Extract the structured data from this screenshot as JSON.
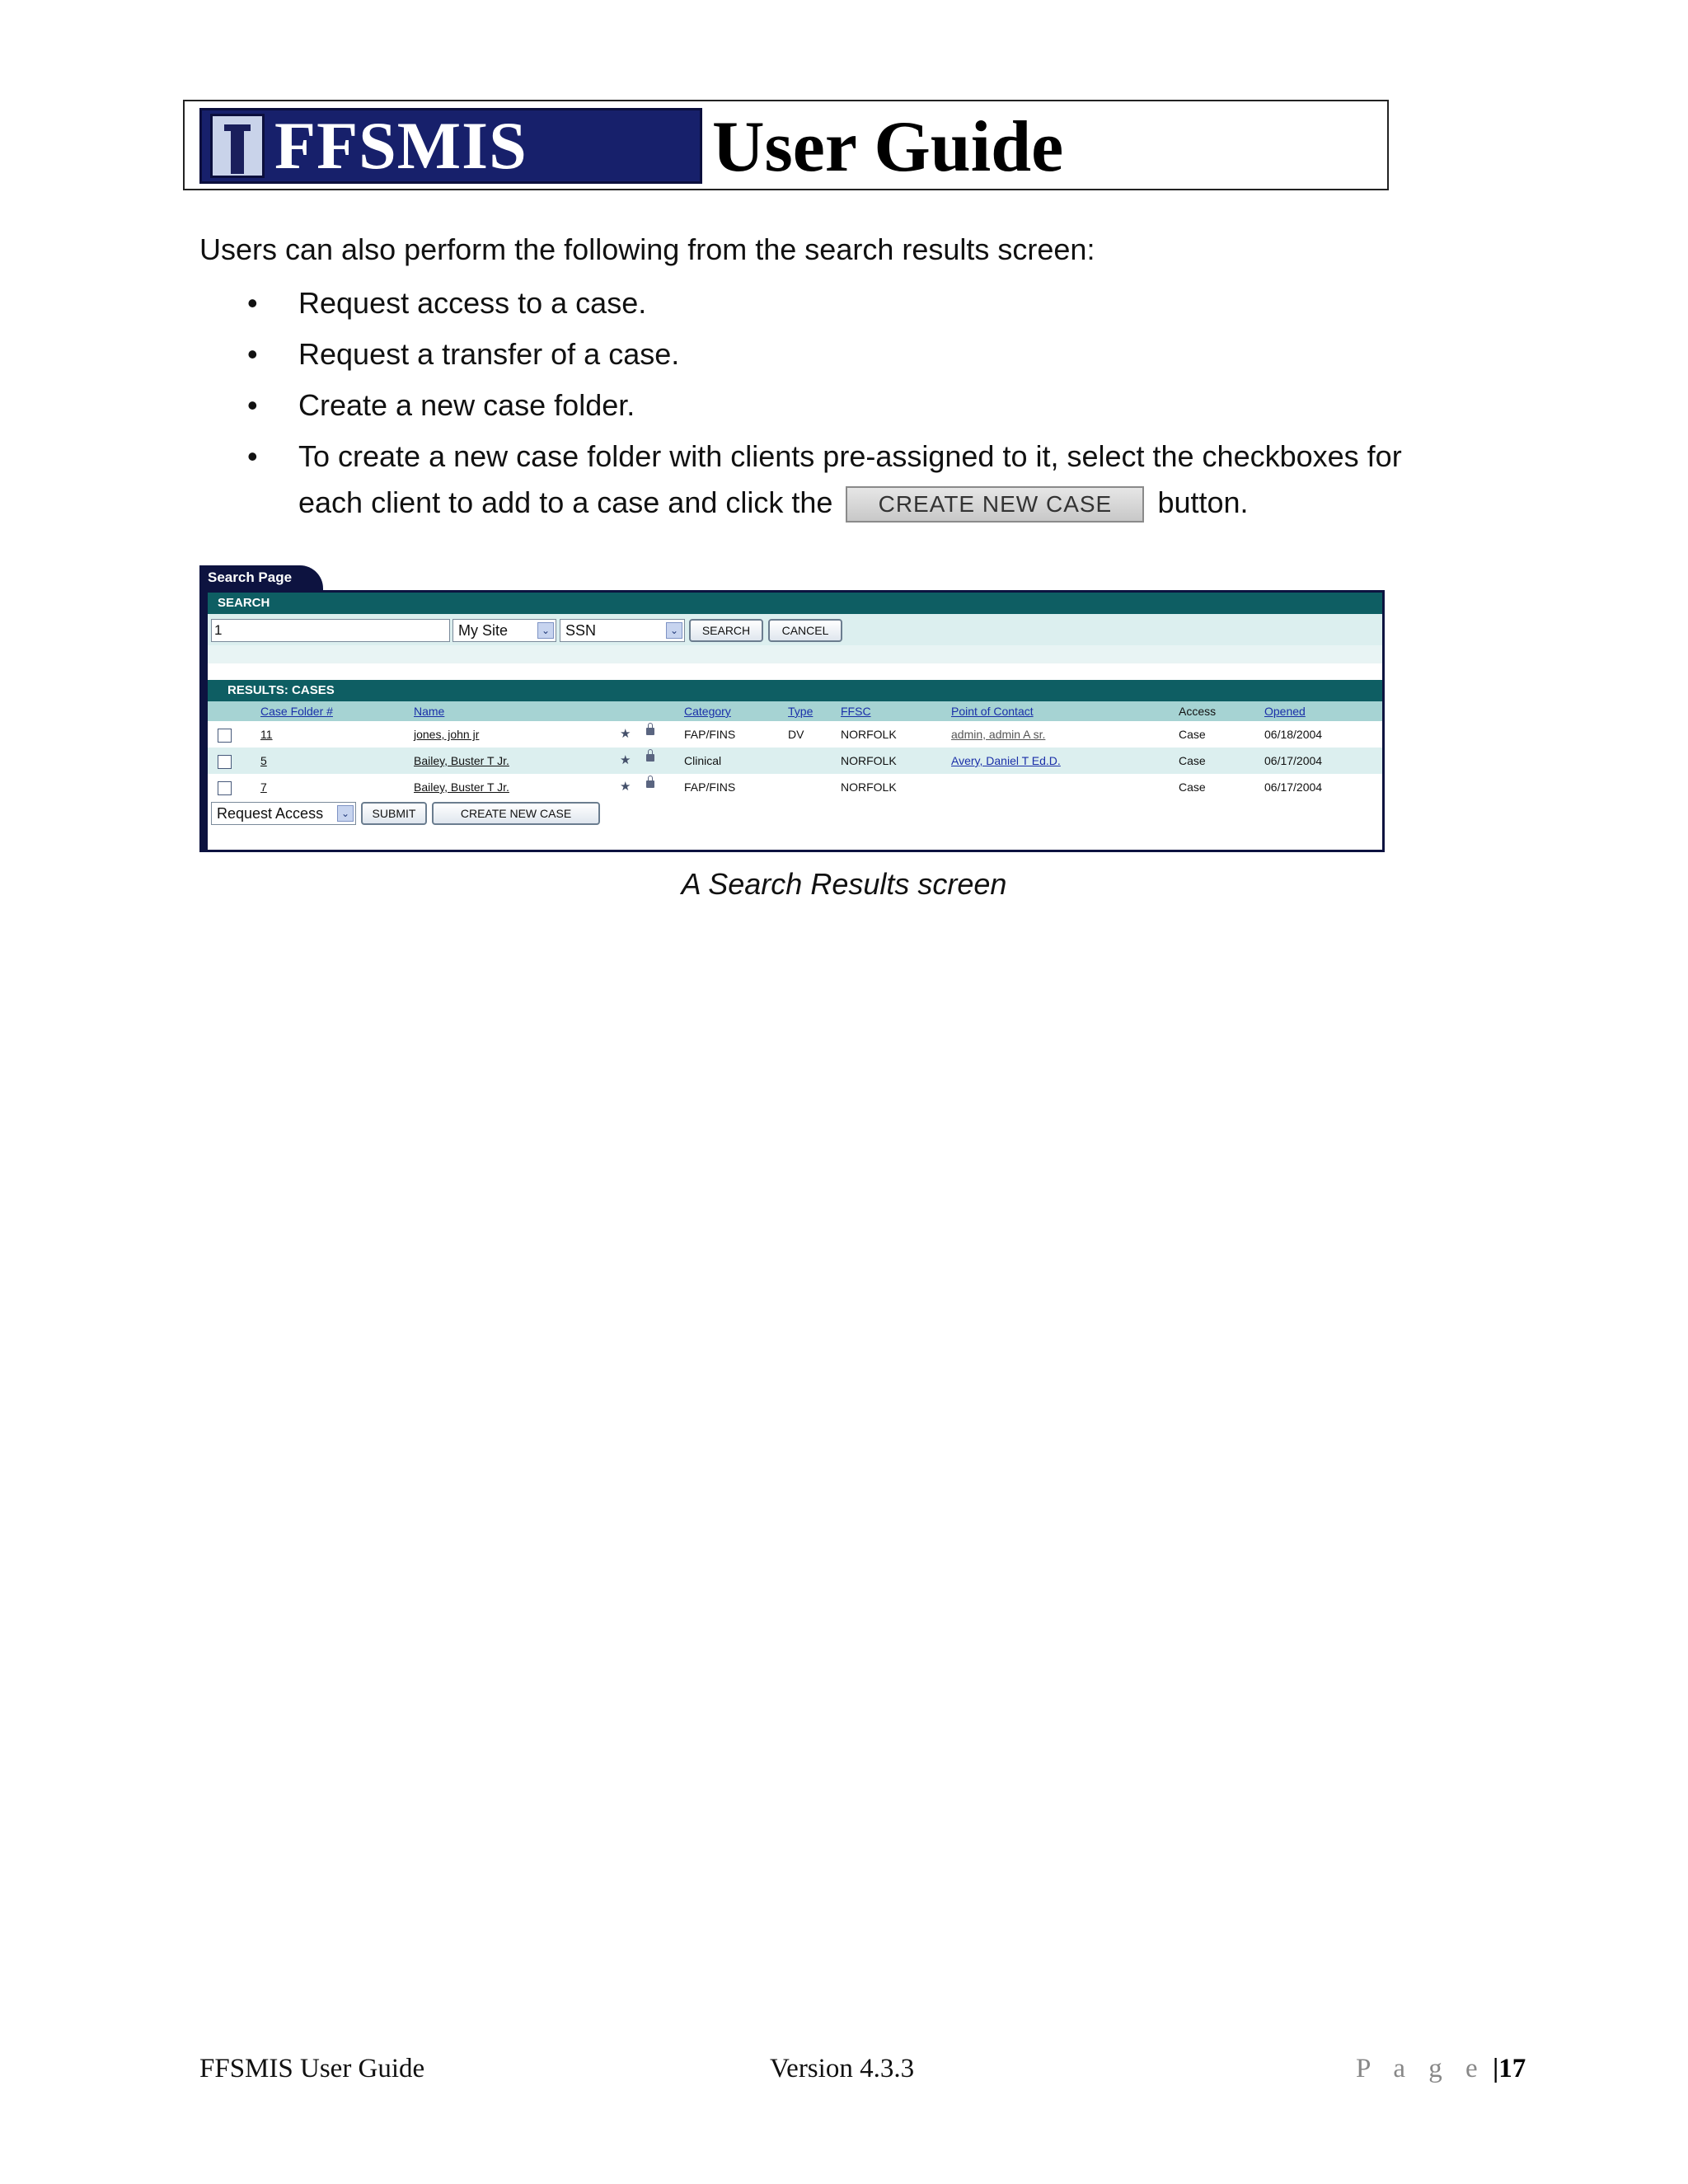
{
  "header": {
    "logo_text": "FFSMIS",
    "title": "User Guide"
  },
  "body": {
    "intro": "Users can also perform the following from the search results screen:",
    "bullet_char": "•",
    "bullets": [
      "Request access to a case.",
      "Request a transfer of a case.",
      "Create a new case folder."
    ],
    "bullet4_part1": "To create a new case folder with clients pre-assigned to it, select the checkboxes for each client to add to a case and click the",
    "bullet4_button": "CREATE NEW CASE",
    "bullet4_part2": "button."
  },
  "screenshot": {
    "tab_label": "Search Page",
    "search_bar": "SEARCH",
    "search_value": "1",
    "site_select": "My Site",
    "type_select": "SSN",
    "search_button": "SEARCH",
    "cancel_button": "CANCEL",
    "results_bar": "RESULTS: CASES",
    "columns": [
      "Case Folder #",
      "Name",
      "Category",
      "Type",
      "FFSC",
      "Point of Contact",
      "Access",
      "Opened"
    ],
    "rows": [
      {
        "folder": "11",
        "name": "jones, john jr",
        "category": "FAP/FINS",
        "type": "DV",
        "ffsc": "NORFOLK",
        "contact": "admin, admin A sr.",
        "access": "Case",
        "opened": "06/18/2004"
      },
      {
        "folder": "5",
        "name": "Bailey, Buster T Jr.",
        "category": "Clinical",
        "type": "",
        "ffsc": "NORFOLK",
        "contact": "Avery, Daniel T Ed.D.",
        "access": "Case",
        "opened": "06/17/2004"
      },
      {
        "folder": "7",
        "name": "Bailey, Buster T Jr.",
        "category": "FAP/FINS",
        "type": "",
        "ffsc": "NORFOLK",
        "contact": "",
        "access": "Case",
        "opened": "06/17/2004"
      }
    ],
    "action_select": "Request Access",
    "submit_button": "SUBMIT",
    "create_button": "CREATE NEW CASE",
    "star_glyph": "★",
    "select_arrow_glyph": "⌄"
  },
  "caption": "A Search Results screen",
  "footer": {
    "left": "FFSMIS User Guide",
    "center": "Version 4.3.3",
    "page_label": "P a g e",
    "separator": "|",
    "page_number": "17"
  }
}
